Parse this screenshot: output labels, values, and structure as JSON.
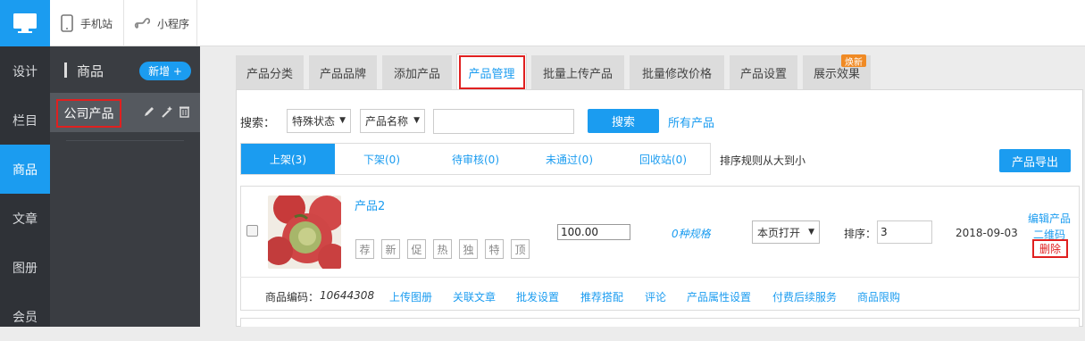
{
  "topbar": {
    "mobile_label": "手机站",
    "miniapp_label": "小程序"
  },
  "rail": {
    "items": [
      {
        "label": "设计"
      },
      {
        "label": "栏目"
      },
      {
        "label": "商品"
      },
      {
        "label": "文章"
      },
      {
        "label": "图册"
      },
      {
        "label": "会员"
      }
    ],
    "active_index": 2
  },
  "panel": {
    "title": "商品",
    "add_label": "新增 +",
    "selected_item": "公司产品"
  },
  "tabs": [
    {
      "label": "产品分类"
    },
    {
      "label": "产品品牌"
    },
    {
      "label": "添加产品"
    },
    {
      "label": "产品管理"
    },
    {
      "label": "批量上传产品"
    },
    {
      "label": "批量修改价格"
    },
    {
      "label": "产品设置"
    },
    {
      "label": "展示效果"
    }
  ],
  "new_badge": "焕新",
  "search": {
    "label": "搜索：",
    "filter_status": "特殊状态",
    "filter_field": "产品名称",
    "button": "搜索",
    "all_link": "所有产品"
  },
  "status_tabs": [
    {
      "label": "上架(3)"
    },
    {
      "label": "下架(0)"
    },
    {
      "label": "待审核(0)"
    },
    {
      "label": "未通过(0)"
    },
    {
      "label": "回收站(0)"
    }
  ],
  "sort_rule": "排序规则从大到小",
  "export_button": "产品导出",
  "product": {
    "name": "产品2",
    "price": "100.00",
    "specs": "0种规格",
    "open_mode": "本页打开",
    "sort_label": "排序：",
    "sort_value": "3",
    "date": "2018-09-03",
    "actions": {
      "edit": "编辑产品",
      "qrcode": "二维码",
      "delete": "删除"
    },
    "tags": [
      "荐",
      "新",
      "促",
      "热",
      "独",
      "特",
      "顶"
    ],
    "code_label": "商品编码：",
    "code_value": "10644308",
    "footer_links": [
      "上传图册",
      "关联文章",
      "批发设置",
      "推荐搭配",
      "评论",
      "产品属性设置",
      "付费后续服务",
      "商品限购"
    ]
  },
  "colors": {
    "accent": "#1b9cf0",
    "highlight": "#e02020",
    "rail": "#2f3237"
  }
}
